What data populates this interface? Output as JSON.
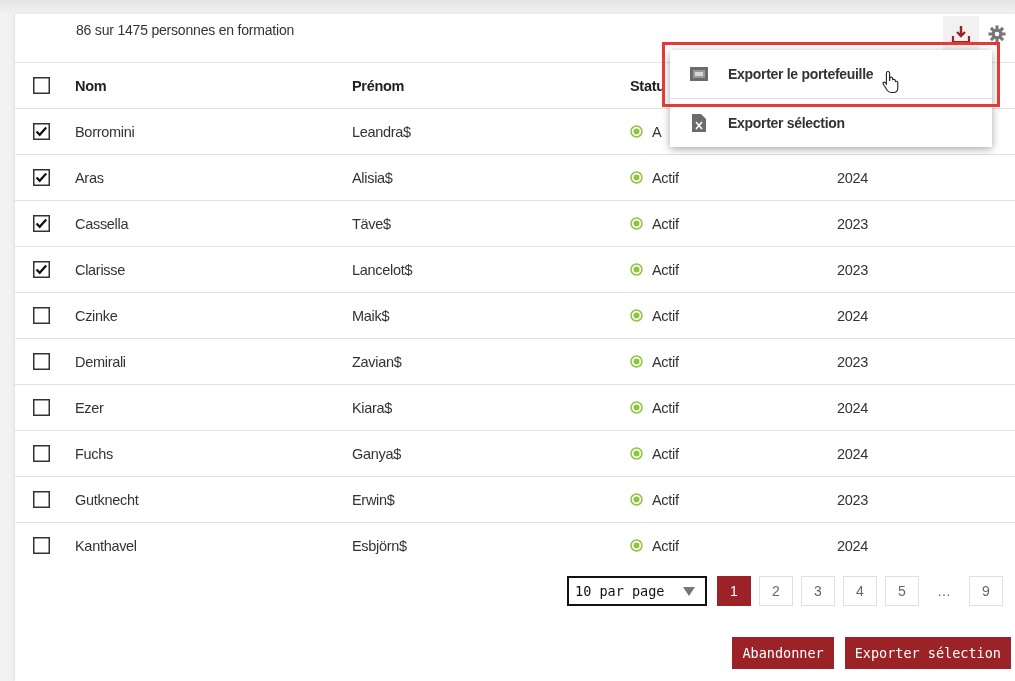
{
  "summary": "86 sur 1475 personnes en formation",
  "menu": [
    {
      "label": "Exporter le portefeuille",
      "kind": "zip",
      "highlighted": true,
      "pointer": true
    },
    {
      "label": "Exporter sélection",
      "kind": "excel",
      "highlighted": false,
      "pointer": false
    }
  ],
  "table": {
    "all_checked": false,
    "columns": [
      "Nom",
      "Prénom",
      "Statu"
    ],
    "rows": [
      {
        "checked": true,
        "nom": "Borromini",
        "prenom": "Leandra$",
        "status": "A"
      },
      {
        "checked": true,
        "nom": "Aras",
        "prenom": "Alisia$",
        "status": "Actif",
        "year": "2024"
      },
      {
        "checked": true,
        "nom": "Cassella",
        "prenom": "Täve$",
        "status": "Actif",
        "year": "2023"
      },
      {
        "checked": true,
        "nom": "Clarisse",
        "prenom": "Lancelot$",
        "status": "Actif",
        "year": "2023"
      },
      {
        "checked": false,
        "nom": "Czinke",
        "prenom": "Maik$",
        "status": "Actif",
        "year": "2024"
      },
      {
        "checked": false,
        "nom": "Demirali",
        "prenom": "Zavian$",
        "status": "Actif",
        "year": "2023"
      },
      {
        "checked": false,
        "nom": "Ezer",
        "prenom": "Kiara$",
        "status": "Actif",
        "year": "2024"
      },
      {
        "checked": false,
        "nom": "Fuchs",
        "prenom": "Ganya$",
        "status": "Actif",
        "year": "2024"
      },
      {
        "checked": false,
        "nom": "Gutknecht",
        "prenom": "Erwin$",
        "status": "Actif",
        "year": "2023"
      },
      {
        "checked": false,
        "nom": "Kanthavel",
        "prenom": "Esbjörn$",
        "status": "Actif",
        "year": "2024"
      }
    ]
  },
  "pager": {
    "per_page": "10 par page",
    "pages": [
      {
        "label": "1",
        "kind": "page",
        "selected": true
      },
      {
        "label": "2",
        "kind": "page",
        "selected": false
      },
      {
        "label": "3",
        "kind": "page",
        "selected": false
      },
      {
        "label": "4",
        "kind": "page",
        "selected": false
      },
      {
        "label": "5",
        "kind": "page",
        "selected": false
      },
      {
        "label": "…",
        "kind": "ellipsis"
      },
      {
        "label": "9",
        "kind": "page",
        "selected": false
      }
    ]
  },
  "buttons": [
    "Abandonner",
    "Exporter sélection"
  ]
}
